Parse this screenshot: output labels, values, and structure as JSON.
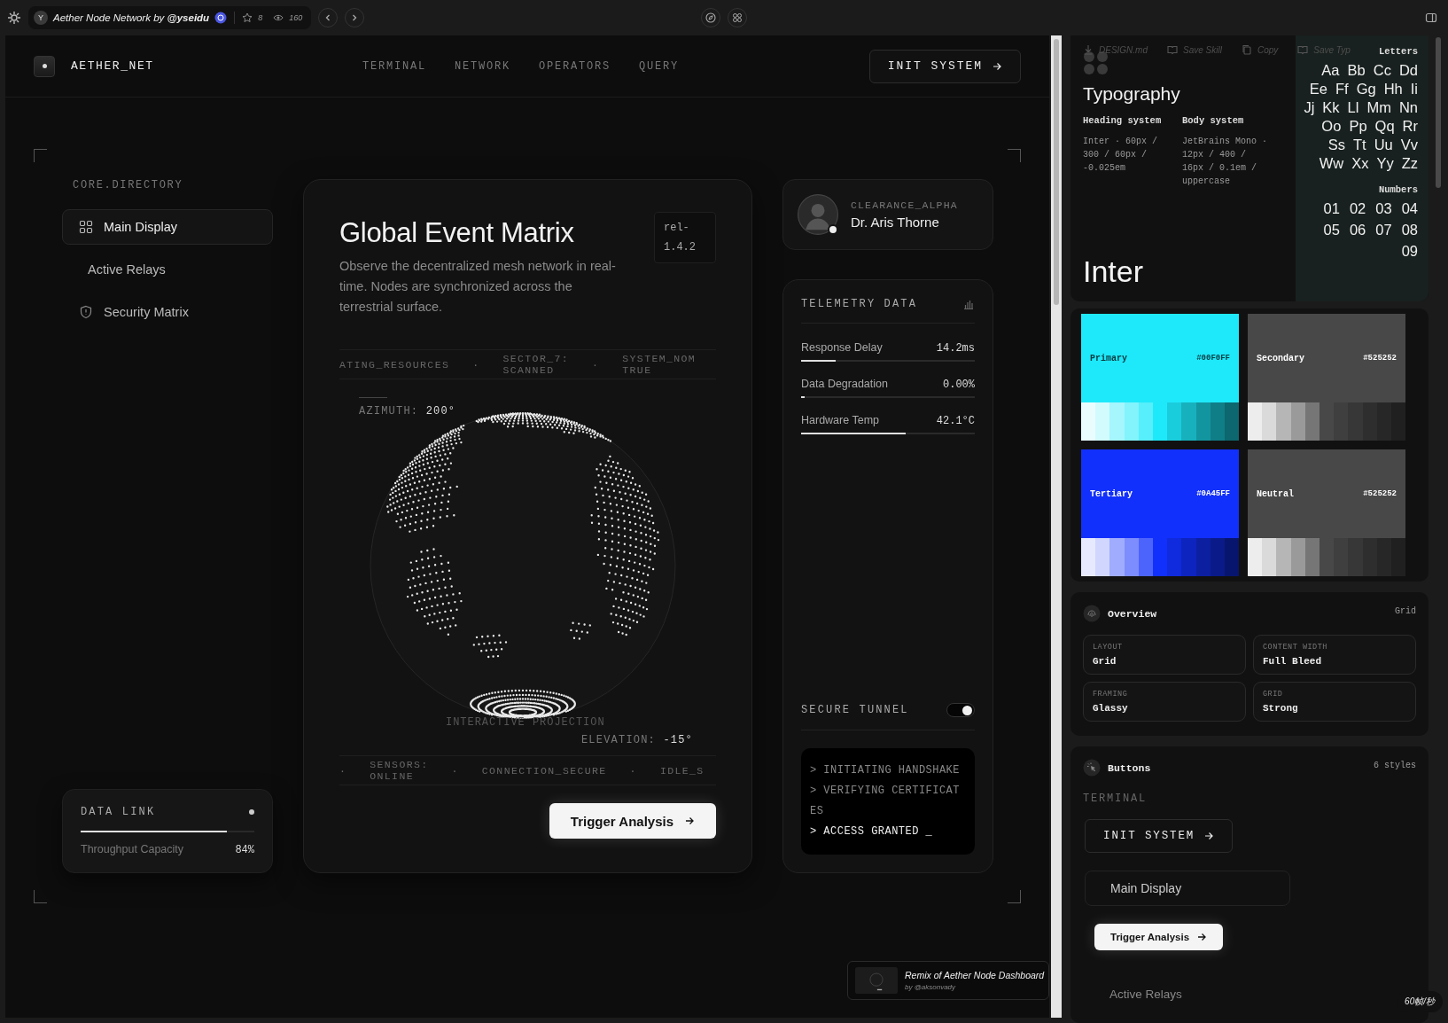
{
  "topbar": {
    "avatar": "Y",
    "title": "Aether Node Network by **@yseidu**",
    "stars": "8",
    "views": "160"
  },
  "header": {
    "brand": "AETHER_NET",
    "nav": [
      "TERMINAL",
      "NETWORK",
      "OPERATORS",
      "QUERY"
    ],
    "cta": "INIT SYSTEM"
  },
  "sidebar": {
    "heading": "CORE.DIRECTORY",
    "items": [
      {
        "label": "Main Display",
        "selected": true
      },
      {
        "label": "Active Relays",
        "selected": false
      },
      {
        "label": "Security Matrix",
        "selected": false
      }
    ]
  },
  "data_link": {
    "title": "DATA LINK",
    "label": "Throughput Capacity",
    "value": "84%",
    "level": 0.84
  },
  "matrix": {
    "title": "Global Event Matrix",
    "version": "rel-1.4.2",
    "description": "Observe the decentralized mesh network in real-time. Nodes are synchronized across the terrestrial surface.",
    "ticker_top": [
      "ATING_RESOURCES",
      "·",
      "SECTOR_7: SCANNED",
      "·",
      "SYSTEM_NOM TRUE"
    ],
    "azimuth_label": "AZIMUTH:",
    "azimuth": "200°",
    "caption": "INTERACTIVE PROJECTION",
    "elevation_label": "ELEVATION:",
    "elevation": "-15°",
    "ticker_bottom": [
      "·",
      "SENSORS: ONLINE",
      "·",
      "CONNECTION_SECURE",
      "·",
      "IDLE_S"
    ],
    "action": "Trigger Analysis"
  },
  "profile": {
    "role": "CLEARANCE_ALPHA",
    "name": "Dr. Aris Thorne",
    "online": true
  },
  "telemetry": {
    "title": "TELEMETRY DATA",
    "metrics": [
      {
        "label": "Response Delay",
        "value": "14.2ms",
        "level": 0.2
      },
      {
        "label": "Data Degradation",
        "value": "0.00%",
        "level": 0.02
      },
      {
        "label": "Hardware Temp",
        "value": "42.1°C",
        "level": 0.6
      }
    ],
    "tunnel_label": "SECURE TUNNEL",
    "tunnel_on": true,
    "console": [
      {
        "text": "> INITIATING HANDSHAKE",
        "active": false
      },
      {
        "text": "> VERIFYING CERTIFICATES",
        "active": false
      },
      {
        "text": "> ACCESS GRANTED _",
        "active": true
      }
    ]
  },
  "remix": {
    "title": "Remix of Aether Node Dashboard",
    "by": "by @aksonvady"
  },
  "design": {
    "toolbar": [
      {
        "label": "DESIGN.md"
      },
      {
        "label": "Save Skill"
      },
      {
        "label": "Copy"
      },
      {
        "label": "Save Typ"
      }
    ],
    "typography": {
      "title": "Typography",
      "systems": [
        {
          "label": "Heading system",
          "spec": "Inter · 60px / 300 / 60px / -0.025em"
        },
        {
          "label": "Body system",
          "spec": "JetBrains Mono · 12px / 400 / 16px / 0.1em / uppercase"
        }
      ],
      "sample": "Inter",
      "letters_title": "Letters",
      "letters": [
        "Aa",
        "Bb",
        "Cc",
        "Dd",
        "Ee",
        "Ff",
        "Gg",
        "Hh",
        "Ii",
        "Jj",
        "Kk",
        "Ll",
        "Mm",
        "Nn",
        "Oo",
        "Pp",
        "Qq",
        "Rr",
        "Ss",
        "Tt",
        "Uu",
        "Vv",
        "Ww",
        "Xx",
        "Yy",
        "Zz"
      ],
      "numbers_title": "Numbers",
      "numbers": [
        "01",
        "02",
        "03",
        "04",
        "05",
        "06",
        "07",
        "08",
        "09"
      ]
    },
    "colors": [
      {
        "name": "Primary",
        "hex": "#00F0FF",
        "color": "#1ee9fa"
      },
      {
        "name": "Secondary",
        "hex": "#525252",
        "color": "#484848"
      },
      {
        "name": "Tertiary",
        "hex": "#0A45FF",
        "color": "#1230fb"
      },
      {
        "name": "Neutral",
        "hex": "#525252",
        "color": "#484848"
      }
    ],
    "overview": {
      "title": "Overview",
      "tag": "Grid",
      "fields": [
        {
          "label": "LAYOUT",
          "value": "Grid"
        },
        {
          "label": "CONTENT WIDTH",
          "value": "Full Bleed"
        },
        {
          "label": "FRAMING",
          "value": "Glassy"
        },
        {
          "label": "GRID",
          "value": "Strong"
        }
      ]
    },
    "buttons": {
      "title": "Buttons",
      "tag": "6 styles",
      "group": "TERMINAL",
      "samples": [
        {
          "kind": "terminal",
          "label": "INIT SYSTEM"
        },
        {
          "kind": "nav",
          "label": "Main Display"
        },
        {
          "kind": "primary",
          "label": "Trigger Analysis"
        },
        {
          "kind": "text",
          "label": "Active Relays"
        }
      ]
    }
  },
  "fps": "60帧/秒"
}
